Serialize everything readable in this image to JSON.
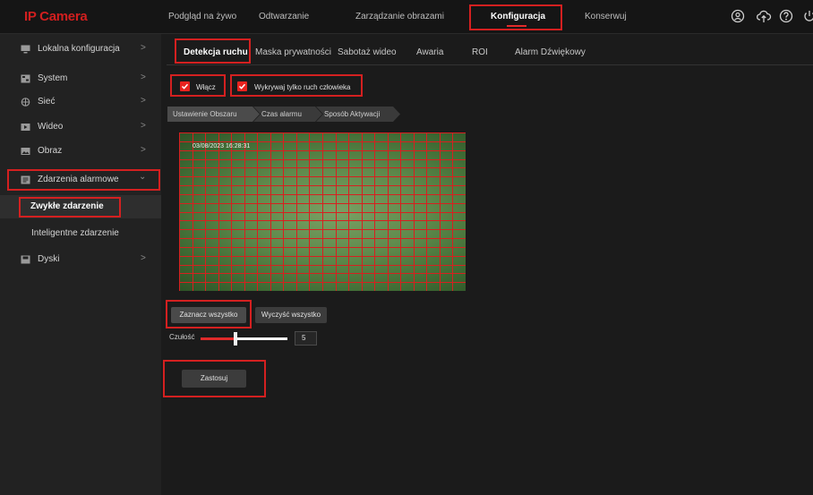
{
  "app": {
    "logo": "IP Camera"
  },
  "top_nav": {
    "items": [
      {
        "label": "Podgląd na żywo"
      },
      {
        "label": "Odtwarzanie"
      },
      {
        "label": "Zarządzanie obrazami"
      },
      {
        "label": "Konfiguracja",
        "active": true
      },
      {
        "label": "Konserwuj"
      }
    ],
    "icons": [
      "user-icon",
      "cloud-upload-icon",
      "help-icon",
      "power-icon"
    ]
  },
  "sidebar": {
    "items": [
      {
        "label": "Lokalna konfiguracja",
        "icon": "monitor-icon"
      },
      {
        "label": "System",
        "icon": "system-icon"
      },
      {
        "label": "Sieć",
        "icon": "network-icon"
      },
      {
        "label": "Wideo",
        "icon": "video-icon"
      },
      {
        "label": "Obraz",
        "icon": "image-icon"
      },
      {
        "label": "Zdarzenia alarmowe",
        "icon": "alarm-events-icon",
        "expanded": true
      },
      {
        "label": "Dyski",
        "icon": "disk-icon"
      }
    ],
    "sub_items": [
      {
        "label": "Zwykłe zdarzenie",
        "selected": true
      },
      {
        "label": "Inteligentne zdarzenie"
      }
    ]
  },
  "tabs": [
    {
      "label": "Detekcja ruchu",
      "active": true
    },
    {
      "label": "Maska prywatności"
    },
    {
      "label": "Sabotaż wideo"
    },
    {
      "label": "Awaria"
    },
    {
      "label": "ROI"
    },
    {
      "label": "Alarm Dźwiękowy"
    }
  ],
  "options": {
    "enable_label": "Włącz",
    "enable_checked": true,
    "human_only_label": "Wykrywaj tylko ruch człowieka",
    "human_only_checked": true
  },
  "steps": [
    "Ustawienie Obszaru",
    "Czas alarmu",
    "Sposób Aktywacji"
  ],
  "video": {
    "timestamp": "03/08/2023  16:28:31"
  },
  "buttons": {
    "select_all": "Zaznacz wszystko",
    "clear_all": "Wyczyść wszystko",
    "apply": "Zastosuj"
  },
  "sensitivity": {
    "label": "Czułość",
    "value": "5",
    "level_fraction": 0.4
  },
  "colors": {
    "accent": "#e02a2a",
    "highlight": "#d42020",
    "grid": "#d81f1f"
  }
}
